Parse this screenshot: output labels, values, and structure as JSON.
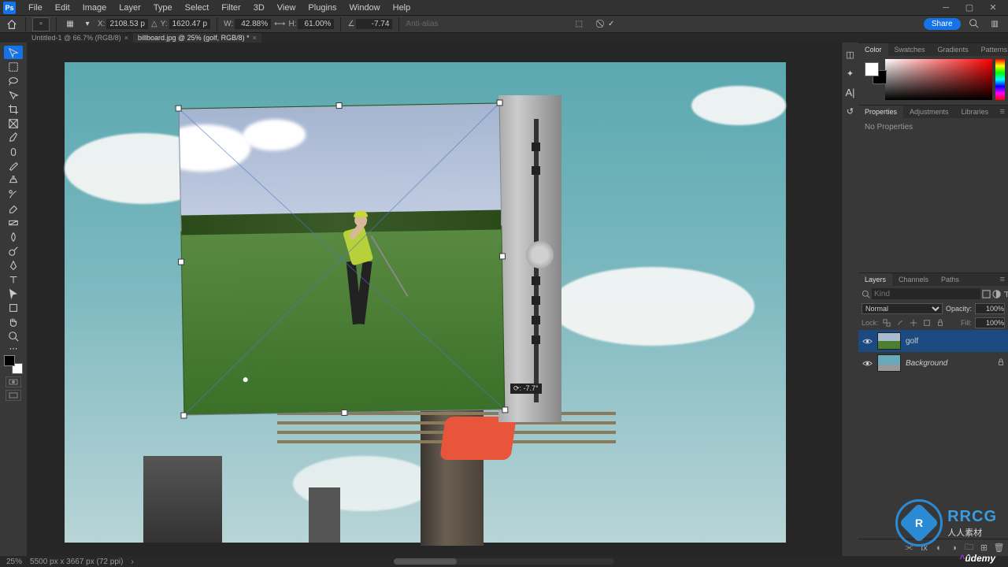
{
  "menu": {
    "items": [
      "File",
      "Edit",
      "Image",
      "Layer",
      "Type",
      "Select",
      "Filter",
      "3D",
      "View",
      "Plugins",
      "Window",
      "Help"
    ]
  },
  "options": {
    "x_value": "2108.53 p",
    "y_value": "1620.47 p",
    "w_value": "42.88%",
    "h_value": "61.00%",
    "rotate_value": "-7.74",
    "antialias_label": "Anti-alias",
    "share_label": "Share"
  },
  "tabs": {
    "items": [
      {
        "label": "Untitled-1 @ 66.7% (RGB/8)",
        "active": false
      },
      {
        "label": "billboard.jpg @ 25% (golf, RGB/8) *",
        "active": true
      }
    ]
  },
  "canvas": {
    "readout": "⟳: -7.7°"
  },
  "panels": {
    "color_tabs": [
      "Color",
      "Swatches",
      "Gradients",
      "Patterns"
    ],
    "props_tabs": [
      "Properties",
      "Adjustments",
      "Libraries"
    ],
    "props_empty": "No Properties",
    "layers_tabs": [
      "Layers",
      "Channels",
      "Paths"
    ]
  },
  "layers": {
    "kind_placeholder": "Kind",
    "blend_mode": "Normal",
    "opacity_label": "Opacity:",
    "opacity_value": "100%",
    "lock_label": "Lock:",
    "fill_label": "Fill:",
    "fill_value": "100%",
    "items": [
      {
        "name": "golf",
        "selected": true,
        "italic": false
      },
      {
        "name": "Background",
        "selected": false,
        "italic": true,
        "locked": true
      }
    ]
  },
  "status": {
    "zoom": "25%",
    "docinfo": "5500 px x 3667 px (72 ppi)"
  },
  "watermark": {
    "rrcg_latin": "RRCG",
    "rrcg_cn": "人人素材",
    "rrcg_badge": "R",
    "udemy": "ûdemy"
  }
}
